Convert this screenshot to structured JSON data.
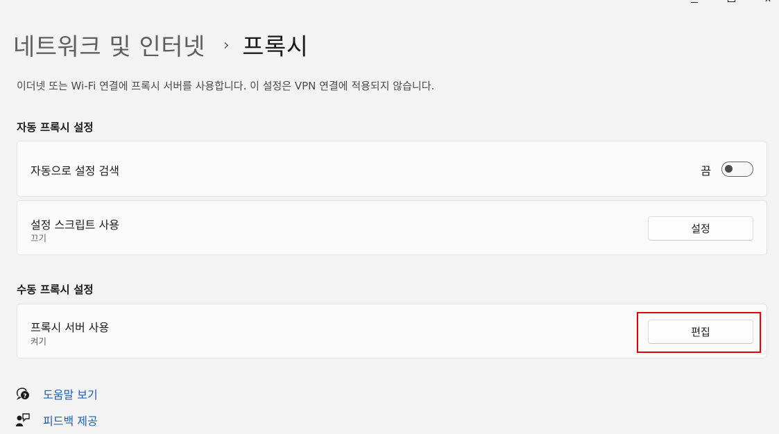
{
  "window": {
    "minimize_icon": "minimize-icon",
    "maximize_icon": "maximize-icon",
    "close_icon": "close-icon",
    "close_glyph": "✕"
  },
  "breadcrumb": {
    "parent": "네트워크 및 인터넷",
    "separator": "›",
    "current": "프록시"
  },
  "description": "이더넷 또는 Wi-Fi 연결에 프록시 서버를 사용합니다. 이 설정은 VPN 연결에 적용되지 않습니다.",
  "auto_section": {
    "heading": "자동 프록시 설정",
    "detect": {
      "label": "자동으로 설정 검색",
      "toggle_state": "끔",
      "toggle_on": false
    },
    "script": {
      "label": "설정 스크립트 사용",
      "status": "끄기",
      "button": "설정"
    }
  },
  "manual_section": {
    "heading": "수동 프록시 설정",
    "proxy_server": {
      "label": "프록시 서버 사용",
      "status": "켜기",
      "button": "편집"
    }
  },
  "help": {
    "get_help": "도움말 보기",
    "feedback": "피드백 제공"
  },
  "colors": {
    "background": "#f3f3f3",
    "card": "#fbfbfb",
    "link": "#1a5fb4",
    "highlight": "#e00000"
  }
}
